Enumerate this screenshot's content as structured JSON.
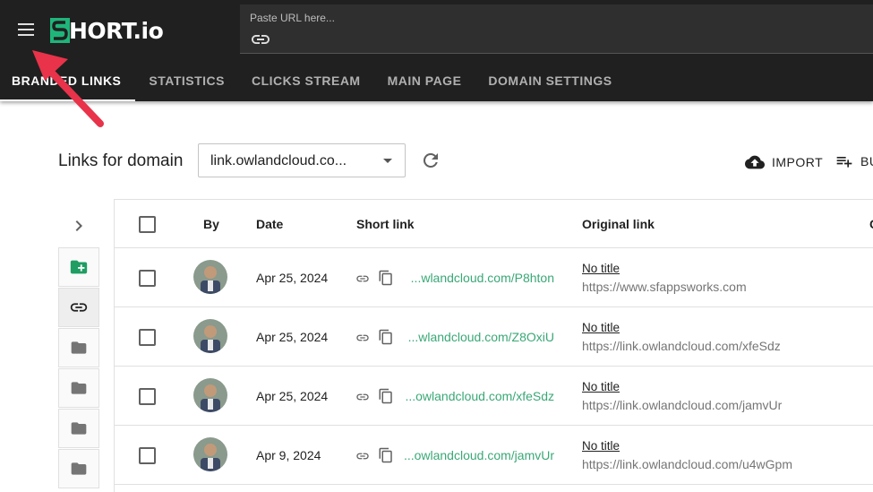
{
  "header": {
    "brand": "HORT.io",
    "url_placeholder": "Paste URL here...",
    "tabs": [
      {
        "label": "BRANDED LINKS",
        "active": true
      },
      {
        "label": "STATISTICS"
      },
      {
        "label": "CLICKS STREAM"
      },
      {
        "label": "MAIN PAGE"
      },
      {
        "label": "DOMAIN SETTINGS"
      }
    ]
  },
  "toolbar": {
    "title": "Links for domain",
    "domain": "link.owlandcloud.co...",
    "import_label": "IMPORT",
    "bulk_label": "BU"
  },
  "table": {
    "columns": [
      "By",
      "Date",
      "Short link",
      "Original link",
      "C"
    ],
    "rows": [
      {
        "date": "Apr 25, 2024",
        "short": "...wlandcloud.com/P8hton",
        "title": "No title",
        "url": "https://www.sfappsworks.com"
      },
      {
        "date": "Apr 25, 2024",
        "short": "...wlandcloud.com/Z8OxiU",
        "title": "No title",
        "url": "https://link.owlandcloud.com/xfeSdz"
      },
      {
        "date": "Apr 25, 2024",
        "short": "...owlandcloud.com/xfeSdz",
        "title": "No title",
        "url": "https://link.owlandcloud.com/jamvUr"
      },
      {
        "date": "Apr 9, 2024",
        "short": "...owlandcloud.com/jamvUr",
        "title": "No title",
        "url": "https://link.owlandcloud.com/u4wGpm"
      }
    ]
  },
  "sidebar": {
    "folders": [
      {
        "icon": "create-folder-icon"
      },
      {
        "icon": "link-icon",
        "active": true
      },
      {
        "icon": "folder-icon"
      },
      {
        "icon": "folder-icon"
      },
      {
        "icon": "folder-icon"
      },
      {
        "icon": "folder-icon"
      }
    ]
  },
  "colors": {
    "topbar": "#202020",
    "accent_green": "#3aa876",
    "arrow": "#e8334a"
  }
}
